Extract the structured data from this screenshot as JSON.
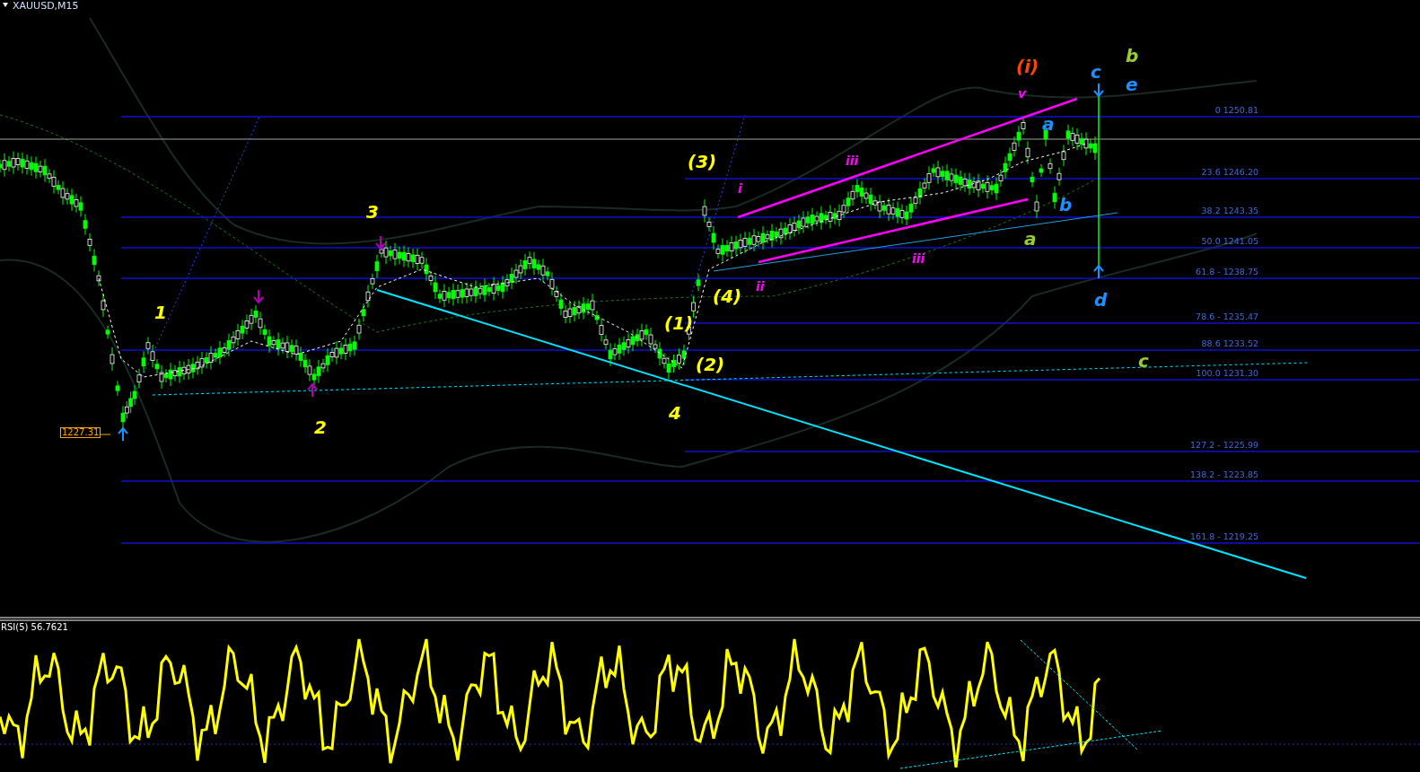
{
  "chart": {
    "title": "XAUUSD,M15",
    "price_tag": "1227.31"
  },
  "fib_levels": [
    {
      "label": "0 1250.81"
    },
    {
      "label": "23.6 1246.20"
    },
    {
      "label": "38.2 1243.35"
    },
    {
      "label": "50.0 1241.05"
    },
    {
      "label": "61.8 - 1238.75"
    },
    {
      "label": "78.6 - 1235.47"
    },
    {
      "label": "88.6 1233.52"
    },
    {
      "label": "100.0 1231.30"
    },
    {
      "label": "127.2 - 1225.99"
    },
    {
      "label": "138.2 - 1223.85"
    },
    {
      "label": "161.8 -  1219.25"
    }
  ],
  "wave_labels": [
    {
      "text": "1",
      "color": "#ffff00"
    },
    {
      "text": "2",
      "color": "#ffff00"
    },
    {
      "text": "3",
      "color": "#ffff00"
    },
    {
      "text": "4",
      "color": "#ffff00"
    },
    {
      "text": "(1)",
      "color": "#ffff00"
    },
    {
      "text": "(2)",
      "color": "#ffff00"
    },
    {
      "text": "(3)",
      "color": "#ffff00"
    },
    {
      "text": "(4)",
      "color": "#ffff00"
    },
    {
      "text": "i",
      "color": "#ff00ff"
    },
    {
      "text": "ii",
      "color": "#ff00ff"
    },
    {
      "text": "iii",
      "color": "#ff00ff"
    },
    {
      "text": "iii",
      "color": "#ff00ff"
    },
    {
      "text": "(i)",
      "color": "#ff4500"
    },
    {
      "text": "v",
      "color": "#ff00ff"
    },
    {
      "text": "a",
      "color": "#1e90ff"
    },
    {
      "text": "b",
      "color": "#1e90ff"
    },
    {
      "text": "c",
      "color": "#1e90ff"
    },
    {
      "text": "d",
      "color": "#1e90ff"
    },
    {
      "text": "e",
      "color": "#1e90ff"
    },
    {
      "text": "a",
      "color": "#9acd32"
    },
    {
      "text": "b",
      "color": "#9acd32"
    },
    {
      "text": "c",
      "color": "#9acd32"
    }
  ],
  "rsi": {
    "label": "RSI(5) 56.7621"
  }
}
